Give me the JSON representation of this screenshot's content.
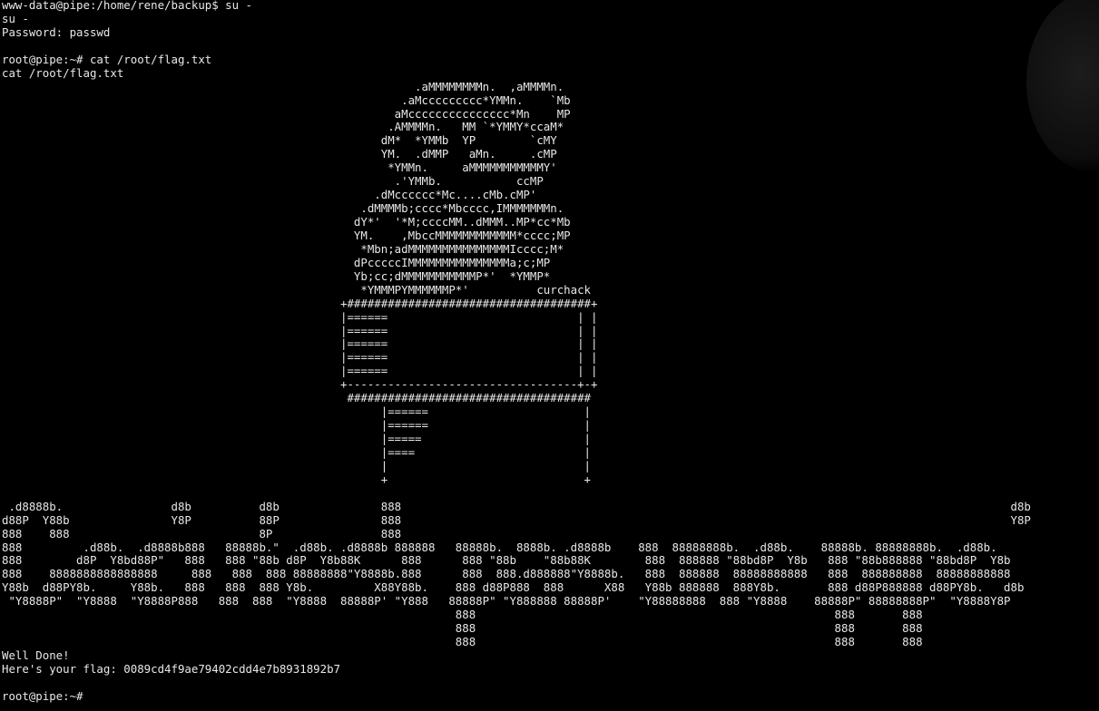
{
  "terminal": {
    "lines": [
      "www-data@pipe:/home/rene/backup$ su -",
      "su -",
      "Password: passwd",
      "",
      "root@pipe:~# cat /root/flag.txt",
      "cat /root/flag.txt",
      "                                                             .aMMMMMMMMn.  ,aMMMMn.",
      "                                                           .aMccccccccc*YMMn.    `Mb",
      "                                                          aMccccccccccccccc*Mn    MP",
      "                                                         .AMMMMn.   MM `*YMMY*ccaM*",
      "                                                        dM*  *YMMb  YP        `cMY",
      "                                                        YM.  .dMMP   aMn.     .cMP",
      "                                                         *YMMn.     aMMMMMMMMMMMY'",
      "                                                          .'YMMb.           ccMP",
      "                                                       .dMcccccc*Mc....cMb.cMP'",
      "                                                     .dMMMMb;cccc*Mbcccc,IMMMMMMMn.",
      "                                                    dY*'  '*M;ccccMM..dMMM..MP*cc*Mb",
      "                                                    YM.    ,MbccMMMMMMMMMMMM*cccc;MP",
      "                                                     *Mbn;adMMMMMMMMMMMMMMMIcccc;M*",
      "                                                    dPcccccIMMMMMMMMMMMMMMMa;c;MP",
      "                                                    Yb;cc;dMMMMMMMMMMMP*'  *YMMP*",
      "                                                     *YMMMPYMMMMMMP*'          curchack",
      "                                                  +####################################+",
      "                                                  |======                            | |",
      "                                                  |======                            | |",
      "                                                  |======                            | |",
      "                                                  |======                            | |",
      "                                                  |======                            | |",
      "                                                  +----------------------------------+-+",
      "                                                   ####################################",
      "                                                        |======                       |",
      "                                                        |======                       |",
      "                                                        |=====                        |",
      "                                                        |====                         |",
      "                                                        |                             |",
      "                                                        +                             +",
      "",
      " .d8888b.                d8b          d8b               888                                                                                          d8b",
      "d88P  Y88b               Y8P          88P               888                                                                                          Y8P",
      "888    888                            8P                888",
      "888         .d88b.  .d8888b888   88888b.\"  .d88b. .d8888b 888888   88888b.  8888b. .d8888b    888  88888888b.  .d88b.    88888b. 88888888b.  .d88b.",
      "888        d8P  Y8bd88P\"   888   888 \"88b d8P  Y8b88K      888      888 \"88b    \"88b88K        888  888888 \"88bd8P  Y8b   888 \"88b888888 \"88bd8P  Y8b",
      "888    8888888888888888     888   888  888 88888888\"Y8888b.888      888  888.d888888\"Y8888b.   888  888888  88888888888   888  888888888  88888888888",
      "Y88b  d88PY8b.     Y88b.   888   888  888 Y8b.         X88Y88b.    888 d88P888  888      X88   Y88b 888888  888Y8b.       888 d88P888888 d88PY8b.   d8b",
      " \"Y8888P\"  \"Y8888  \"Y8888P888   888  888  \"Y8888  88888P' \"Y888   88888P\" \"Y888888 88888P'    \"Y88888888  888 \"Y8888    88888P\" 88888888P\"  \"Y8888Y8P",
      "                                                                   888                                                     888       888",
      "                                                                   888                                                     888       888",
      "                                                                   888                                                     888       888",
      "Well Done!",
      "Here's your flag: 0089cd4f9ae79402cdd4e7b8931892b7",
      "",
      "root@pipe:~# "
    ]
  }
}
